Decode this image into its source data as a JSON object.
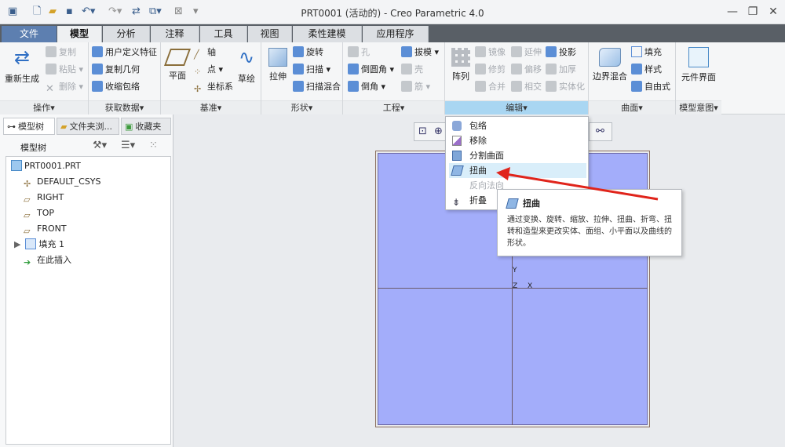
{
  "window": {
    "title": "PRT0001 (活动的) - Creo Parametric 4.0",
    "minimize": "—",
    "restore": "❐",
    "close": "✕"
  },
  "quick_access": [
    "new-icon",
    "open-icon",
    "save-icon",
    "undo-icon",
    "redo-icon",
    "regenerate-icon",
    "windows-icon",
    "close-window-icon"
  ],
  "tabs": [
    "文件",
    "模型",
    "分析",
    "注释",
    "工具",
    "视图",
    "柔性建模",
    "应用程序"
  ],
  "active_tab": "模型",
  "ribbon": {
    "operations": {
      "label": "操作▾",
      "regenerate": "重新生成",
      "copy": "复制",
      "paste": "粘贴 ▾",
      "delete": "删除 ▾"
    },
    "getdata": {
      "label": "获取数据▾",
      "udf": "用户定义特征",
      "copygeom": "复制几何",
      "shrinkwrap": "收缩包络"
    },
    "datum": {
      "label": "基准▾",
      "plane": "平面",
      "axis": "轴",
      "point": "点 ▾",
      "csys": "坐标系",
      "sketch": "草绘"
    },
    "shapes": {
      "label": "形状▾",
      "extrude": "拉伸",
      "revolve": "旋转",
      "sweep": "扫描 ▾",
      "swept_blend": "扫描混合"
    },
    "engineering": {
      "label": "工程▾",
      "hole": "孔",
      "round": "倒圆角 ▾",
      "chamfer": "倒角 ▾",
      "draft": "拔模 ▾",
      "shell": "壳",
      "rib": "筋 ▾"
    },
    "editing": {
      "label": "编辑▾",
      "pattern": "阵列",
      "mirror": "镜像",
      "trim": "修剪",
      "merge": "合并",
      "extend": "延伸",
      "offset": "偏移",
      "intersect": "相交",
      "project": "投影",
      "thicken": "加厚",
      "solidify": "实体化"
    },
    "surfaces": {
      "label": "曲面▾",
      "boundary_blend": "边界混合",
      "fill": "填充",
      "style": "样式",
      "freestyle": "自由式"
    },
    "model_intent": {
      "label": "模型意图▾",
      "component_interface": "元件界面"
    }
  },
  "left_panel": {
    "tabs": [
      "模型树",
      "文件夹浏...",
      "收藏夹"
    ],
    "tree_label": "模型树",
    "items": [
      "PRT0001.PRT",
      "DEFAULT_CSYS",
      "RIGHT",
      "TOP",
      "FRONT",
      "填充 1",
      "在此插入"
    ]
  },
  "dropdown": {
    "items": [
      "包络",
      "移除",
      "分割曲面",
      "扭曲",
      "反向法向",
      "折叠"
    ],
    "hovered": "扭曲"
  },
  "tooltip": {
    "title": "扭曲",
    "body": "通过变换、旋转、缩放、拉伸、扭曲、折弯、扭转和造型来更改实体、面组、小平面以及曲线的形状。"
  },
  "csys_labels": {
    "y": "Y",
    "z": "Z",
    "x": "X"
  },
  "colors": {
    "surface": "#a3adfa",
    "accent": "#5d7fb0",
    "highlight": "#a9d6f2",
    "arrow": "#e0241b"
  }
}
